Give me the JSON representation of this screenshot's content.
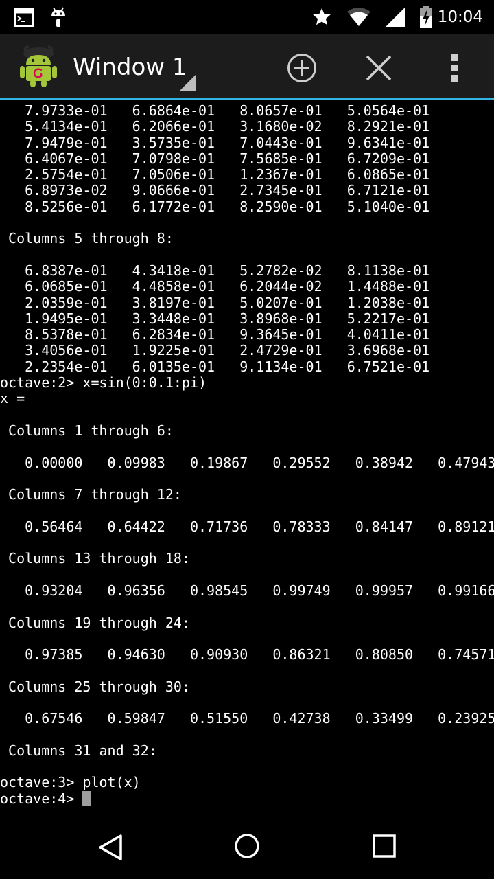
{
  "status_bar": {
    "time": "10:04",
    "left_icons": [
      "terminal-notification-icon",
      "android-notification-icon"
    ],
    "right_icons": [
      "star-icon",
      "wifi-icon",
      "cell-signal-icon",
      "battery-icon"
    ]
  },
  "action_bar": {
    "window_title": "Window 1",
    "app_icon": "android-debian-icon",
    "actions": [
      "add-window-icon",
      "close-window-icon",
      "overflow-menu-icon"
    ]
  },
  "terminal": {
    "accent_color": "#33b5e5",
    "lines": [
      "   7.9733e-01   6.6864e-01   8.0657e-01   5.0564e-01",
      "   5.4134e-01   6.2066e-01   3.1680e-02   8.2921e-01",
      "   7.9479e-01   3.5735e-01   7.0443e-01   9.6341e-01",
      "   6.4067e-01   7.0798e-01   7.5685e-01   6.7209e-01",
      "   2.5754e-01   7.0506e-01   1.2367e-01   6.0865e-01",
      "   6.8973e-02   9.0666e-01   2.7345e-01   6.7121e-01",
      "   8.5256e-01   6.1772e-01   8.2590e-01   5.1040e-01",
      "",
      " Columns 5 through 8:",
      "",
      "   6.8387e-01   4.3418e-01   5.2782e-02   8.1138e-01",
      "   6.0685e-01   4.4858e-01   6.2044e-02   1.4488e-01",
      "   2.0359e-01   3.8197e-01   5.0207e-01   1.2038e-01",
      "   1.9495e-01   3.3448e-01   3.8968e-01   5.2217e-01",
      "   8.5378e-01   6.2834e-01   9.3645e-01   4.0411e-01",
      "   3.4056e-01   1.9225e-01   2.4729e-01   3.6968e-01",
      "   2.2354e-01   6.0135e-01   9.1134e-01   6.7521e-01",
      "octave:2> x=sin(0:0.1:pi)",
      "x =",
      "",
      " Columns 1 through 6:",
      "",
      "   0.00000   0.09983   0.19867   0.29552   0.38942   0.47943",
      "",
      " Columns 7 through 12:",
      "",
      "   0.56464   0.64422   0.71736   0.78333   0.84147   0.89121",
      "",
      " Columns 13 through 18:",
      "",
      "   0.93204   0.96356   0.98545   0.99749   0.99957   0.99166",
      "",
      " Columns 19 through 24:",
      "",
      "   0.97385   0.94630   0.90930   0.86321   0.80850   0.74571",
      "",
      " Columns 25 through 30:",
      "",
      "   0.67546   0.59847   0.51550   0.42738   0.33499   0.23925",
      "",
      " Columns 31 and 32:",
      "",
      "octave:3> plot(x)"
    ],
    "prompt": "octave:4> "
  },
  "nav_bar": {
    "buttons": [
      "back-icon",
      "home-icon",
      "recents-icon"
    ]
  }
}
